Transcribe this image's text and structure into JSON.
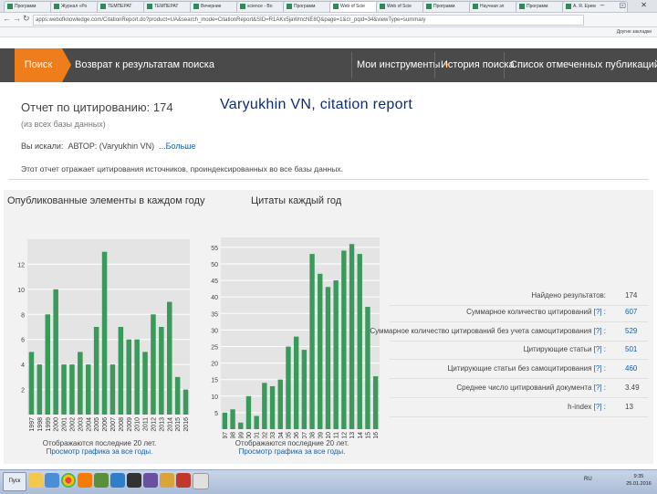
{
  "browser": {
    "tabs": [
      {
        "label": "Программ"
      },
      {
        "label": "Журнал «Ро"
      },
      {
        "label": "ТЕМПЕРАТ"
      },
      {
        "label": "ТЕМПЕРАТ"
      },
      {
        "label": "Вечерние"
      },
      {
        "label": "science - Bo"
      },
      {
        "label": "Программ"
      },
      {
        "label": "Web of Scie"
      },
      {
        "label": "Web of Scie"
      },
      {
        "label": "Программ"
      },
      {
        "label": "Научная эл"
      },
      {
        "label": "Программ"
      },
      {
        "label": "А. Я. Ерем"
      }
    ],
    "window_controls": "– ▢ ✕",
    "url": "apps.webofknowledge.com/CitationReport.do?product=UA&search_mode=CitationReport&SID=R1AKx5jaWmcNE8Q&page=1&cr_pqid=34&viewType=summary",
    "bookmarks_right": "Другие закладки"
  },
  "header": {
    "search_label": "Поиск",
    "back_label": "Возврат к результатам поиска",
    "my_tools_label": "Мои инструменты",
    "history_label": "История поиска",
    "marked_label": "Список отмеченных публикаций"
  },
  "report": {
    "title": "Отчет по цитированию: 174",
    "subtitle": "(из всех базы данных)",
    "searched_prefix": "Вы искали:",
    "searched_query": "АВТОР: (Varyukhin VN)",
    "more_link": "...Больше",
    "note": "Этот отчет отражает цитирования источников, проиндексированных во все базы данных."
  },
  "overlay_title": "Varyukhin VN, citation report",
  "charts": {
    "footnote": "Отображаются последние 20 лет.",
    "link": "Просмотр графика за все годы."
  },
  "chart_data": [
    {
      "type": "bar",
      "title": "Опубликованные элементы в каждом году",
      "categories": [
        "1997",
        "1998",
        "1999",
        "2000",
        "2001",
        "2002",
        "2003",
        "2004",
        "2005",
        "2006",
        "2007",
        "2008",
        "2009",
        "2010",
        "2011",
        "2012",
        "2013",
        "2014",
        "2015",
        "2016"
      ],
      "values": [
        5,
        4,
        8,
        10,
        4,
        4,
        5,
        4,
        7,
        13,
        4,
        7,
        6,
        6,
        5,
        8,
        7,
        9,
        3,
        2
      ],
      "yticks": [
        2,
        4,
        6,
        8,
        10,
        12
      ],
      "ylim": [
        0,
        14
      ],
      "grid": true,
      "bar_color": "#3a9a5b"
    },
    {
      "type": "bar",
      "title": "Цитаты каждый год",
      "categories": [
        "1997",
        "1998",
        "1999",
        "2000",
        "2001",
        "2002",
        "2003",
        "2004",
        "2005",
        "2006",
        "2007",
        "2008",
        "2009",
        "2010",
        "2011",
        "2012",
        "2013",
        "2014",
        "2015",
        "2016"
      ],
      "values": [
        5,
        6,
        2,
        10,
        4,
        14,
        13,
        15,
        25,
        28,
        24,
        53,
        47,
        43,
        45,
        54,
        56,
        53,
        37,
        16
      ],
      "yticks": [
        5,
        10,
        15,
        20,
        25,
        30,
        35,
        40,
        45,
        50,
        55
      ],
      "ylim": [
        0,
        58
      ],
      "grid": true,
      "bar_color": "#3a9a5b"
    }
  ],
  "stats": [
    {
      "label": "Найдено результатов:",
      "help": "",
      "value": "174",
      "link": false
    },
    {
      "label": "Суммарное количество цитирований",
      "help": "[?]",
      "value": "607",
      "link": true
    },
    {
      "label": "Суммарное количество цитирований без учета самоцитирования",
      "help": "[?]",
      "value": "529",
      "link": true
    },
    {
      "label": "Цитирующие статьи",
      "help": "[?]",
      "value": "501",
      "link": true
    },
    {
      "label": "Цитирующие статьи без самоцитирования",
      "help": "[?]",
      "value": "460",
      "link": true
    },
    {
      "label": "Среднее число цитирований документа",
      "help": "[?]",
      "value": "3.49",
      "link": false
    },
    {
      "label": "h-index",
      "help": "[?]",
      "value": "13",
      "link": false
    }
  ],
  "taskbar": {
    "start_label": "Пуск",
    "tray_lang": "RU",
    "clock_time": "9:35",
    "clock_date": "25.01.2016"
  }
}
